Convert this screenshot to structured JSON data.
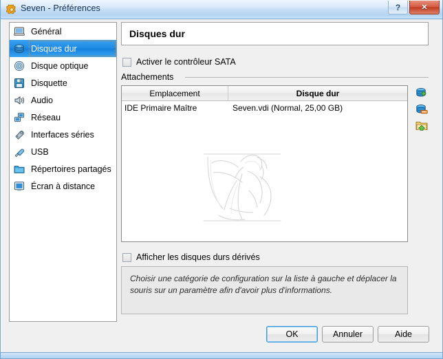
{
  "window": {
    "title": "Seven - Préférences",
    "icon": "gear-icon",
    "help_label": "?",
    "close_label": "✕"
  },
  "sidebar": {
    "items": [
      {
        "label": "Général",
        "icon": "monitor-icon",
        "selected": false
      },
      {
        "label": "Disques dur",
        "icon": "hard-disk-icon",
        "selected": true
      },
      {
        "label": "Disque optique",
        "icon": "optical-disc-icon",
        "selected": false
      },
      {
        "label": "Disquette",
        "icon": "floppy-disk-icon",
        "selected": false
      },
      {
        "label": "Audio",
        "icon": "speaker-icon",
        "selected": false
      },
      {
        "label": "Réseau",
        "icon": "network-icon",
        "selected": false
      },
      {
        "label": "Interfaces séries",
        "icon": "serial-port-icon",
        "selected": false
      },
      {
        "label": "USB",
        "icon": "usb-plug-icon",
        "selected": false
      },
      {
        "label": "Répertoires partagés",
        "icon": "shared-folder-icon",
        "selected": false
      },
      {
        "label": "Écran à distance",
        "icon": "remote-display-icon",
        "selected": false
      }
    ]
  },
  "page": {
    "title": "Disques dur",
    "sata_checkbox": {
      "label": "Activer le contrôleur SATA",
      "checked": false
    },
    "derived_checkbox": {
      "label": "Afficher les disques durs dérivés",
      "checked": false
    },
    "group_label": "Attachements"
  },
  "table": {
    "columns": [
      "Emplacement",
      "Disque dur"
    ],
    "rows": [
      {
        "emplacement": "IDE Primaire Maître",
        "disque": "Seven.vdi (Normal, 25,00 GB)"
      }
    ]
  },
  "toolbar": {
    "add_label": "add-hard-disk",
    "remove_label": "remove-hard-disk",
    "select_label": "select-hard-disk-file"
  },
  "info": {
    "text": "Choisir une catégorie de configuration sur la liste à gauche et déplacer la souris sur un paramètre afin d'avoir plus d'informations."
  },
  "buttons": {
    "ok": "OK",
    "cancel": "Annuler",
    "help": "Aide"
  },
  "colors": {
    "selection_blue": "#1f8ae4",
    "titlebar_blue": "#b5d4f2",
    "close_red": "#bf3d23",
    "panel_gray": "#f0f0f0",
    "info_gray": "#e9e9e9"
  }
}
